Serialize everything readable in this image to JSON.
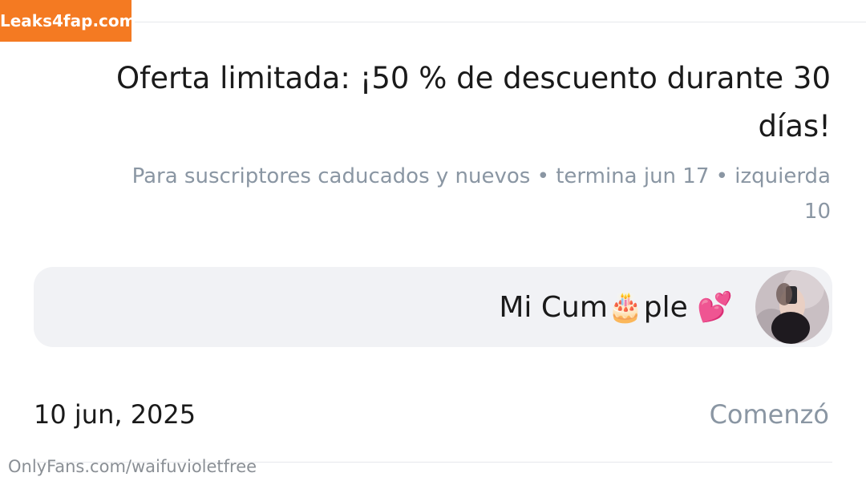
{
  "watermark": {
    "label": "Leaks4fap.com"
  },
  "offer": {
    "title": "Oferta limitada: ¡50 % de descuento durante 30 días!",
    "subtitle": "Para suscriptores caducados y nuevos  •  termina jun 17  •  izquierda 10"
  },
  "profile": {
    "display_name": "Mi Cum🎂ple 💕"
  },
  "started": {
    "label": "Comenzó",
    "value": "10 jun, 2025"
  },
  "footer": {
    "watermark": "OnlyFans.com/waifuvioletfree"
  }
}
